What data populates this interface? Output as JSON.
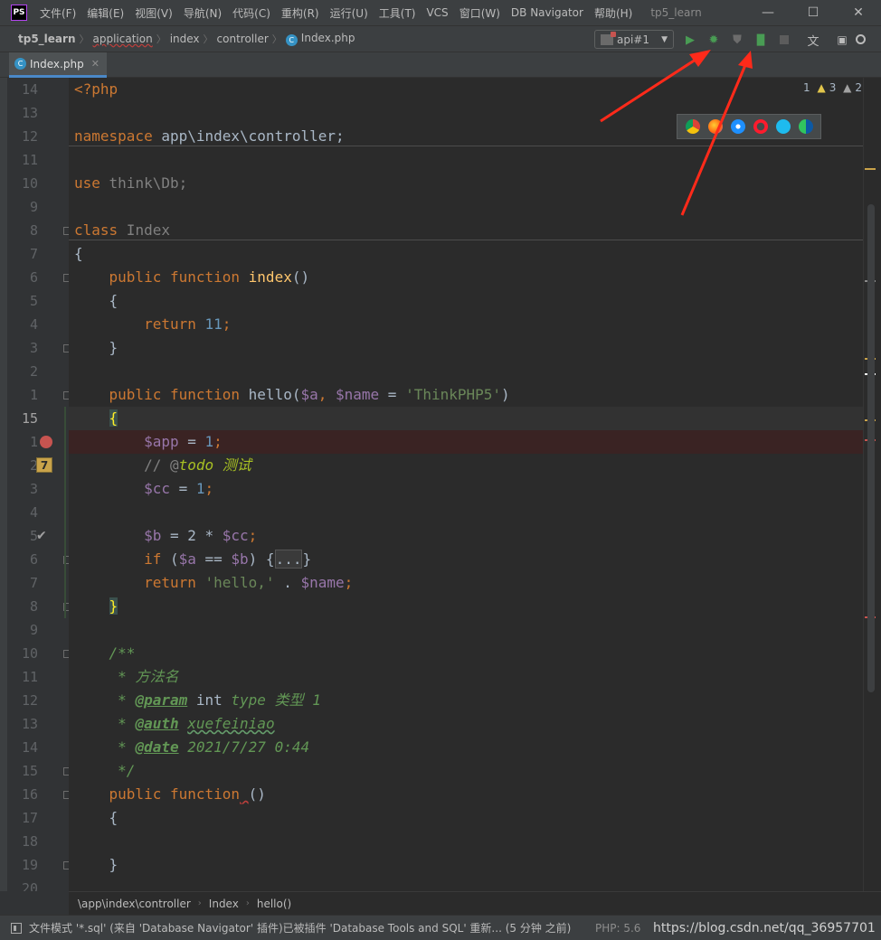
{
  "window": {
    "logo": "PS",
    "menus": [
      "文件(F)",
      "编辑(E)",
      "视图(V)",
      "导航(N)",
      "代码(C)",
      "重构(R)",
      "运行(U)",
      "工具(T)",
      "VCS",
      "窗口(W)",
      "DB Navigator",
      "帮助(H)"
    ],
    "title": "tp5_learn",
    "controls": {
      "minimize": "—",
      "maximize": "☐",
      "close": "✕"
    }
  },
  "navbar": {
    "crumbs": [
      "tp5_learn",
      "application",
      "index",
      "controller",
      "Index.php"
    ],
    "run_config": "api#1"
  },
  "tab": {
    "label": "Index.php",
    "file_icon": "C"
  },
  "inspections": {
    "errors": "1",
    "warnings": "3",
    "weak": "2",
    "ok": "1"
  },
  "editor": {
    "line_numbers": [
      "14",
      "13",
      "12",
      "11",
      "10",
      "9",
      "8",
      "7",
      "6",
      "5",
      "4",
      "3",
      "2",
      "1",
      "15",
      "1",
      "2",
      "3",
      "4",
      "5",
      "6",
      "7",
      "8",
      "9",
      "10",
      "11",
      "12",
      "13",
      "14",
      "15",
      "16",
      "17",
      "18",
      "19",
      "20"
    ],
    "todo_badge": "7",
    "tokens": {
      "php_open": "<?php",
      "namespace_kw": "namespace",
      "namespace_val": " app\\index\\controller;",
      "use_kw": "use",
      "use_val": " think\\Db;",
      "class_kw": "class",
      "class_name": " Index",
      "open_brace": "{",
      "close_brace": "}",
      "public_function": "public function",
      "index_name": " index",
      "parens": "()",
      "return_kw": "return",
      "num_11": " 11",
      "semi": ";",
      "hello_name": " hello(",
      "var_a": "$a",
      "comma": ", ",
      "var_name": "$name",
      "eq": " = ",
      "str_tp5": "'ThinkPHP5'",
      "close_paren": ")",
      "var_app": "$app",
      "num_1": "1",
      "comment_prefix": "// @",
      "todo_word": "todo",
      "todo_text": " 测试",
      "var_cc": "$cc",
      "var_b": "$b",
      "eq_2": " = 2 * ",
      "if_kw": "if",
      "if_open": " (",
      "eqeq": " == ",
      "if_close": ") {",
      "fold_dots": "...",
      "str_hello": "'hello,'",
      "concat": " . ",
      "doc_open": "/**",
      "doc_star": " * ",
      "doc_title": "方法名",
      "tag_param": "@param",
      "param_type": " int ",
      "param_rest": "type 类型 1",
      "tag_auth": "@auth",
      "auth_name": "xuefeiniao",
      "tag_date": "@date",
      "date_val": " 2021/7/27 0:44",
      "doc_close": " */",
      "fn_missing": " ",
      "empty_parens": "()"
    }
  },
  "footer_breadcrumb": [
    "\\app\\index\\controller",
    "Index",
    "hello()"
  ],
  "statusbar": {
    "message": "文件模式 '*.sql' (来自 'Database Navigator' 插件)已被插件 'Database Tools and SQL' 重新... (5 分钟 之前)",
    "php_version": "PHP: 5.6",
    "watermark": "https://blog.csdn.net/qq_36957701"
  },
  "colors": {
    "accent": "#4a88c7",
    "arrow": "#ff2a1a",
    "breakpoint": "#c75450"
  }
}
